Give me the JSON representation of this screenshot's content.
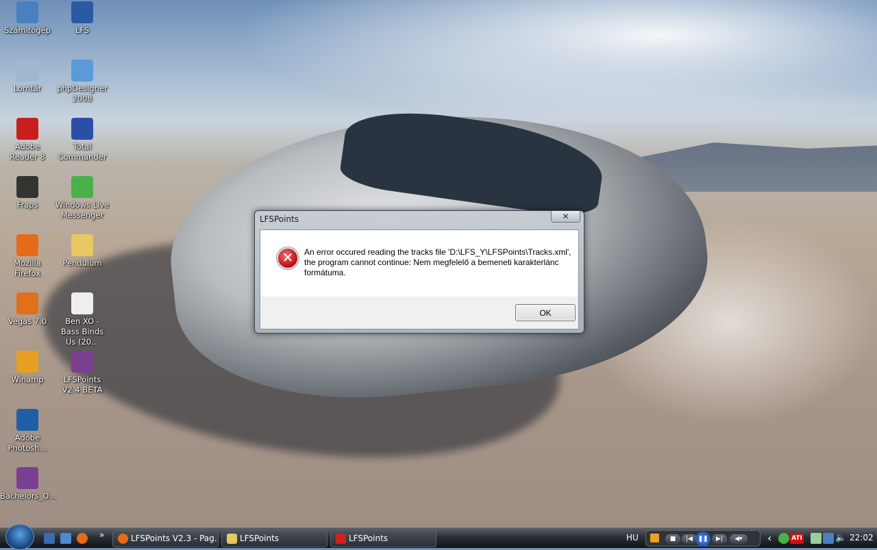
{
  "desktop": {
    "icons": [
      {
        "label": "Számítógép",
        "color": "#4a7fc0"
      },
      {
        "label": "Lomtár",
        "color": "#9fb8d0"
      },
      {
        "label": "Adobe Reader 8",
        "color": "#c81e1e"
      },
      {
        "label": "Fraps",
        "color": "#333333"
      },
      {
        "label": "Mozilla Firefox",
        "color": "#e66a1a"
      },
      {
        "label": "Vegas 7.0",
        "color": "#e0701a"
      },
      {
        "label": "Winamp",
        "color": "#e8a020"
      },
      {
        "label": "Adobe Photosh...",
        "color": "#1f5fa8"
      },
      {
        "label": "Bachelors_O...",
        "color": "#7a3f8f"
      },
      {
        "label": "LFS",
        "color": "#2a5aa0"
      },
      {
        "label": "phpDesigner 2008",
        "color": "#5a9ad8"
      },
      {
        "label": "Total Commander",
        "color": "#2a4fa8"
      },
      {
        "label": "Windows Live Messenger",
        "color": "#4ab04a"
      },
      {
        "label": "Pendulum",
        "color": "#e8c860"
      },
      {
        "label": "Ben XO - Bass Binds Us (20...",
        "color": "#eeeeee"
      },
      {
        "label": "LFSPoints V2.4 BETA",
        "color": "#7a3f8f"
      }
    ]
  },
  "dialog": {
    "title": "LFSPoints",
    "close": "✕",
    "icon": "error-icon",
    "message": "An error occured reading the tracks file 'D:\\LFS_Y\\LFSPoints\\Tracks.xml', the program cannot continue: Nem megfelelő a bemeneti karakterlánc formátuma.",
    "ok": "OK"
  },
  "taskbar": {
    "overflow": "»",
    "buttons": [
      {
        "label": "LFSPoints V2.3 - Pag...",
        "icon": "firefox-icon",
        "color": "#e66a1a"
      },
      {
        "label": "LFSPoints",
        "icon": "folder-icon",
        "color": "#e8c860"
      },
      {
        "label": "LFSPoints",
        "icon": "lfs-icon",
        "color": "#d02020"
      }
    ],
    "language": "HU",
    "clock": "22:02",
    "tray_expand": "‹",
    "ati": "ATI"
  }
}
